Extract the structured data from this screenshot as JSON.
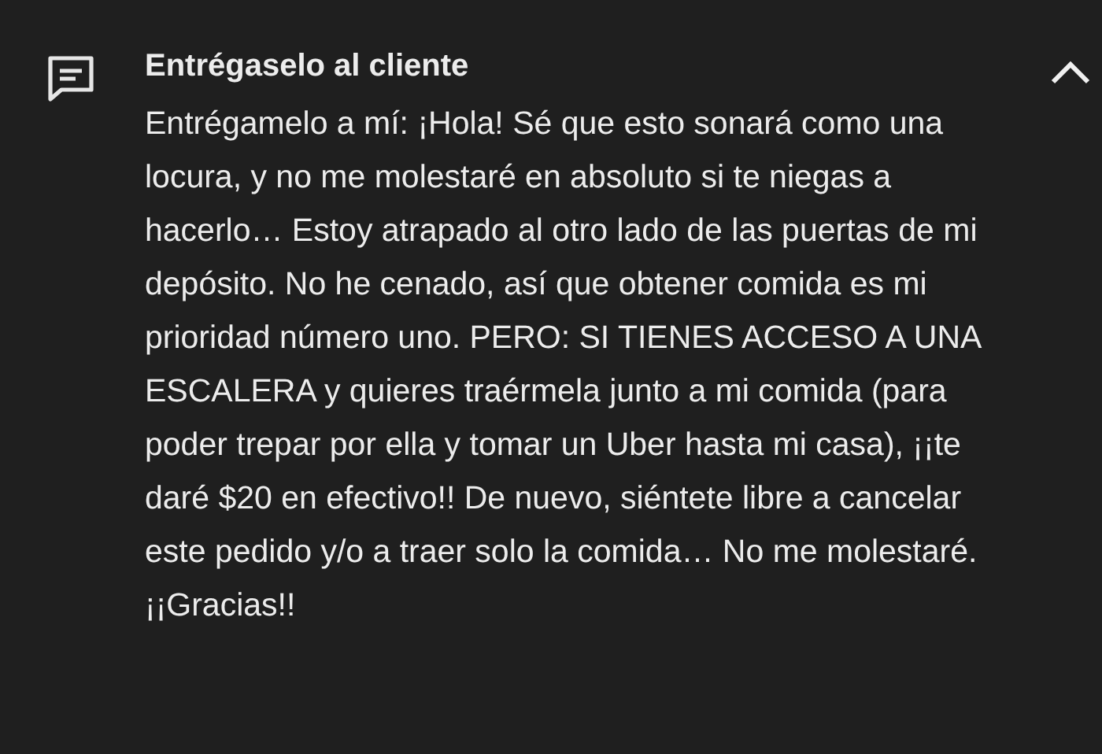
{
  "note": {
    "title": "Entrégaselo al cliente",
    "expanded": true,
    "text": "Entrégamelo a mí: ¡Hola! Sé que esto sonará como una locura, y no me molestaré en absoluto si te niegas a hacerlo… Estoy atrapado al otro lado de las puertas de mi depósito. No he cenado, así que obtener comida es mi prioridad número uno. PERO: SI TIENES ACCESO A UNA ESCALERA y quieres traérmela junto a mi comida (para poder trepar por ella y tomar un Uber hasta mi casa), ¡¡te daré $20 en efectivo!! De nuevo, siéntete libre a cancelar este pedido y/o a traer solo la comida… No me molestaré. ¡¡Gracias!!"
  }
}
